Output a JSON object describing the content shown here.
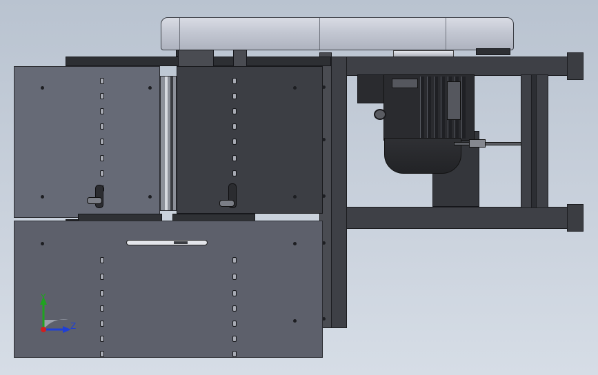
{
  "viewport": {
    "background_top": "#b9c3d0",
    "background_bottom": "#d6dde6"
  },
  "model": {
    "belt_guard_color": "#c3c7d2",
    "frame_color": "#3e4046",
    "panel_color": "#5d606b",
    "motor_color": "#2a2b2f"
  },
  "triad": {
    "y_label": "Y",
    "z_label": "Z",
    "y_color": "#1fa31f",
    "z_color": "#1f3fd6",
    "x_color": "#d01f1f"
  }
}
